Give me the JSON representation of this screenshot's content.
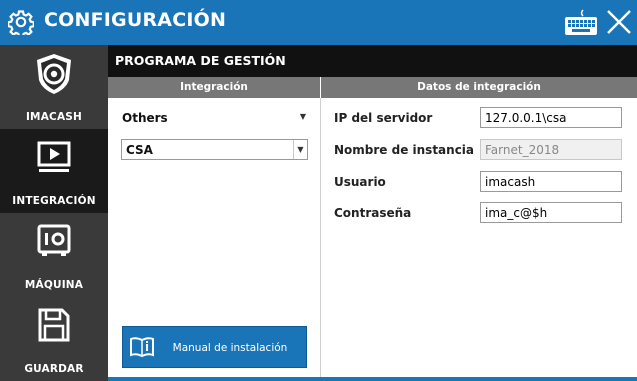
{
  "titlebar": {
    "title": "CONFIGURACIÓN",
    "icon": "gear-icon",
    "color": "#1a75b8"
  },
  "sidebar": {
    "items": [
      {
        "label": "IMACASH",
        "icon": "imacash-logo-icon",
        "active": false
      },
      {
        "label": "INTEGRACIÓN",
        "icon": "play-screen-icon",
        "active": true
      },
      {
        "label": "MÁQUINA",
        "icon": "safe-icon",
        "active": false
      },
      {
        "label": "GUARDAR",
        "icon": "save-icon",
        "active": false
      }
    ]
  },
  "main": {
    "section_title": "PROGRAMA DE GESTIÓN",
    "integration": {
      "header": "Integración",
      "type_value": "Others",
      "system_value": "CSA",
      "manual_button": "Manual de instalación"
    },
    "details": {
      "header": "Datos de integración",
      "server_ip": {
        "label": "IP del servidor",
        "value": "127.0.0.1\\csa"
      },
      "instance_name": {
        "label": "Nombre de instancia",
        "value": "Farnet_2018"
      },
      "user": {
        "label": "Usuario",
        "value": "imacash"
      },
      "password": {
        "label": "Contraseña",
        "value": "ima_c@$h"
      }
    }
  }
}
